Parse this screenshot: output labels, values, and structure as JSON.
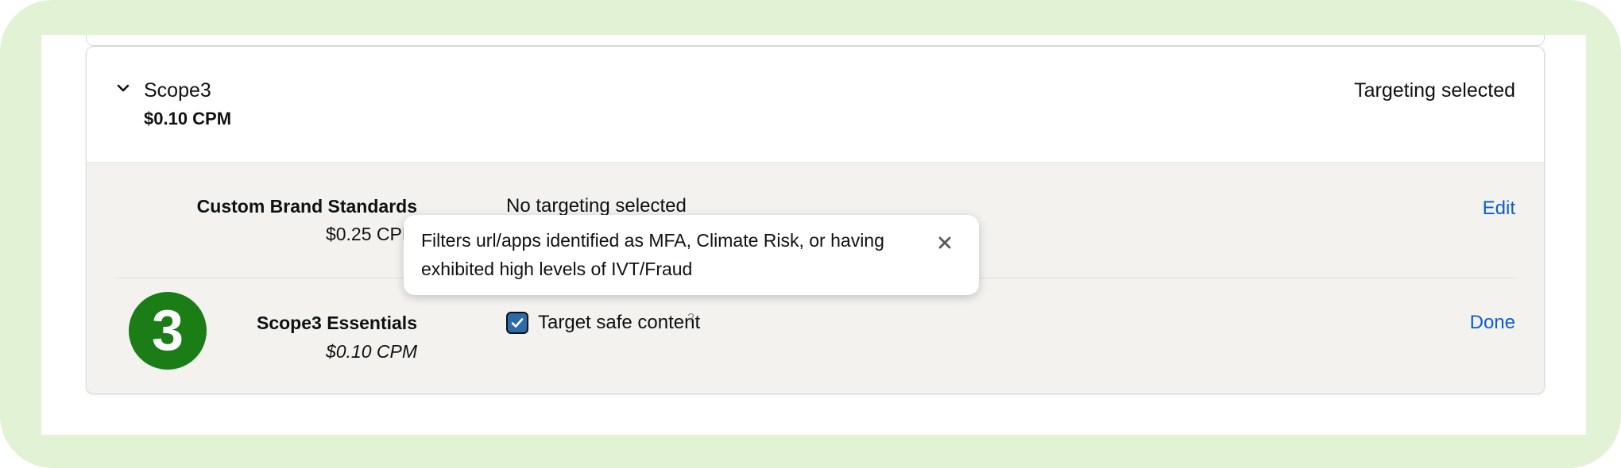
{
  "provider": {
    "name": "Scope3",
    "price": "$0.10 CPM",
    "status": "Targeting selected"
  },
  "segments": [
    {
      "name": "Custom Brand Standards",
      "price": "$0.25 CPM",
      "status": "No targeting selected",
      "action": "Edit"
    },
    {
      "name": "Scope3 Essentials",
      "price": "$0.10 CPM",
      "checkbox_label": "Target safe content",
      "checkbox_checked": true,
      "help_mark": "?",
      "action": "Done"
    }
  ],
  "tooltip": {
    "text": "Filters url/apps identified as MFA, Climate Risk, or having exhibited high levels of IVT/Fraud",
    "close_icon": "close-icon"
  },
  "step_badge": "3",
  "colors": {
    "outer_frame": "#e2f2d5",
    "body_background": "#f3f2ef",
    "link": "#0b5ccf",
    "checkbox": "#2c6ba8",
    "badge": "#1a7d15"
  }
}
